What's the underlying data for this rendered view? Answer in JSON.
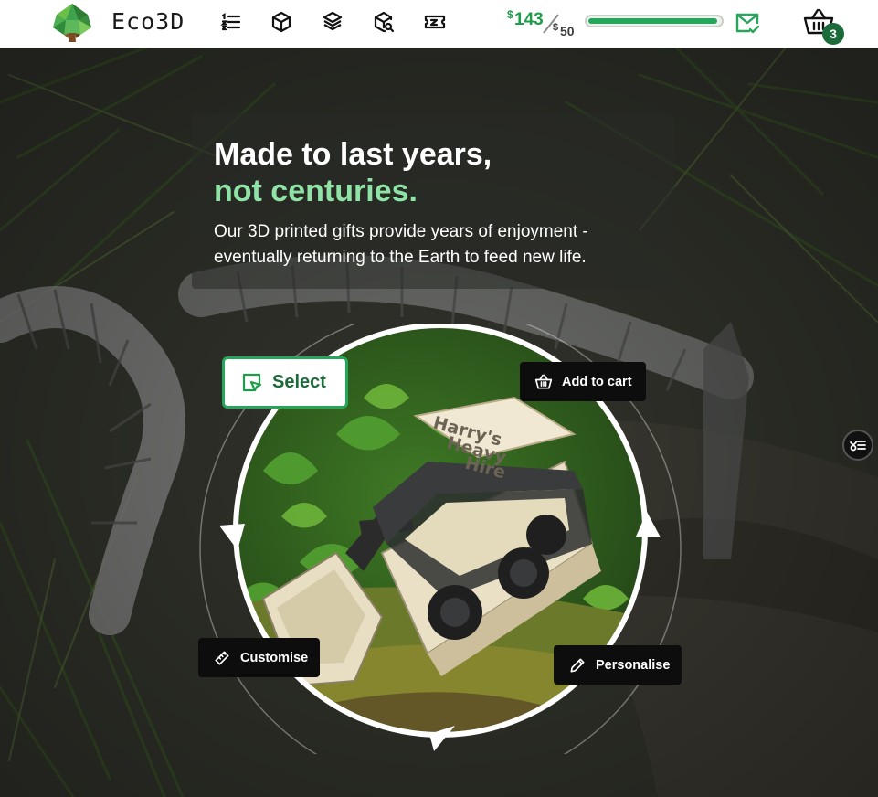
{
  "header": {
    "brand": "Eco3D",
    "nav_icons": [
      "list-icon",
      "box-icon",
      "layers-box-icon",
      "box-search-icon",
      "ticket-icon"
    ],
    "cart_total": {
      "currency": "$",
      "amount": "143"
    },
    "threshold": {
      "currency": "$",
      "amount": "50"
    },
    "progress_fraction": 0.98,
    "cart_count": "3",
    "accent": "#26a65b"
  },
  "hero": {
    "title_line1": "Made to last years,",
    "title_line2": "not centuries.",
    "subtitle": "Our 3D printed gifts provide years of enjoyment - eventually returning to the Earth to feed new life.",
    "highlight_color": "#8fe3a6",
    "product_sign": [
      "Harry's",
      "Heavy",
      "Hire"
    ]
  },
  "actions": {
    "select": "Select",
    "add_to_cart": "Add to cart",
    "customise": "Customise",
    "personalise": "Personalise"
  }
}
